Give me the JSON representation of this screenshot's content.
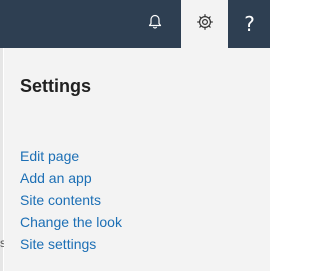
{
  "topbar": {
    "background": "#2e3f52",
    "notifications_icon": "bell-icon",
    "settings_icon": "gear-icon",
    "help_icon": "question-icon",
    "help_glyph": "?"
  },
  "left_edge": {
    "glyph": "s"
  },
  "panel": {
    "title": "Settings",
    "items": [
      {
        "label": "Edit page"
      },
      {
        "label": "Add an app"
      },
      {
        "label": "Site contents"
      },
      {
        "label": "Change the look"
      },
      {
        "label": "Site settings"
      }
    ],
    "link_color": "#1c6fb5"
  }
}
